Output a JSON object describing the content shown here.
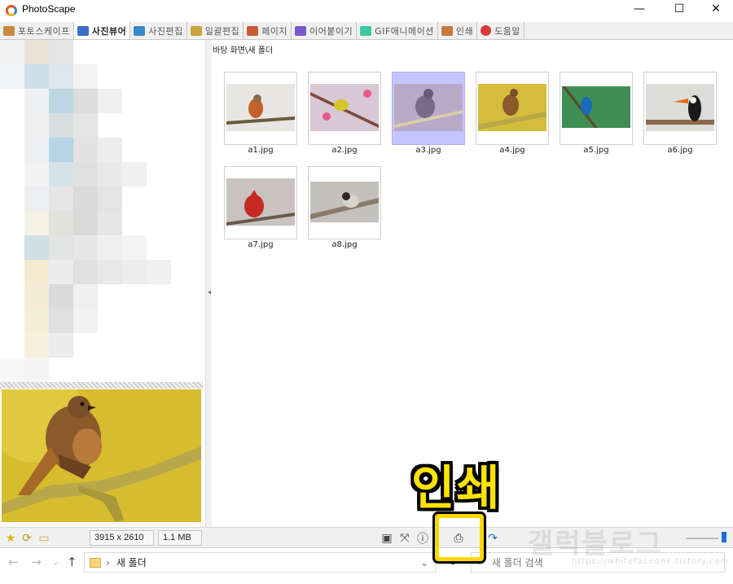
{
  "window": {
    "title": "PhotoScape",
    "minimize": "—",
    "maximize": "☐",
    "close": "✕"
  },
  "tabs": [
    {
      "label": "포토스케이프",
      "color": "#c98a3a",
      "active": false
    },
    {
      "label": "사진뷰어",
      "color": "#3a6fc9",
      "active": true
    },
    {
      "label": "사진편집",
      "color": "#3a8ac9",
      "active": false
    },
    {
      "label": "일괄편집",
      "color": "#c9a43a",
      "active": false
    },
    {
      "label": "페이지",
      "color": "#c95a3a",
      "active": false
    },
    {
      "label": "이어붙이기",
      "color": "#7a5ac9",
      "active": false
    },
    {
      "label": "GIF애니메이션",
      "color": "#3ac9a0",
      "active": false
    },
    {
      "label": "인쇄",
      "color": "#c97a3a",
      "active": false
    },
    {
      "label": "도움말",
      "color": "#d93a3a",
      "active": false
    }
  ],
  "path": "바탕 화면\\새 폴더",
  "thumbnails": [
    {
      "label": "a1.jpg",
      "selected": false,
      "bg": "#e8e6e2",
      "bird": "#c4622d",
      "branch": "#6b5a3a"
    },
    {
      "label": "a2.jpg",
      "selected": false,
      "bg": "#d8c8d6",
      "bird": "#d6c62a",
      "branch": "#7a4a3a"
    },
    {
      "label": "a3.jpg",
      "selected": true,
      "bg": "#b9a9c8",
      "bird": "#7a6a8a",
      "branch": "#d8cfa8"
    },
    {
      "label": "a4.jpg",
      "selected": false,
      "bg": "#d4bd3a",
      "bird": "#8a5a2a",
      "branch": "#b8a848"
    },
    {
      "label": "a5.jpg",
      "selected": false,
      "bg": "#3f8f55",
      "bird": "#1a6ab8",
      "branch": "#5a4a2a"
    },
    {
      "label": "a6.jpg",
      "selected": false,
      "bg": "#dcdcd8",
      "bird": "#1a1a1a",
      "branch": "#8a6a4a"
    },
    {
      "label": "a7.jpg",
      "selected": false,
      "bg": "#c8c2c0",
      "bird": "#c42a22",
      "branch": "#6a5a4a"
    },
    {
      "label": "a8.jpg",
      "selected": false,
      "bg": "#c4c0bc",
      "bird": "#2a2a2a",
      "branch": "#8a7a6a"
    }
  ],
  "overlay": {
    "label": "인쇄"
  },
  "status": {
    "dimensions": "3915 x 2610",
    "filesize": "1.1 MB",
    "icons": [
      "star-icon",
      "rotate-icon",
      "folder-icon",
      "slideshow-icon",
      "fullscreen-icon",
      "info-icon",
      "print-icon",
      "redo-icon"
    ]
  },
  "explorer": {
    "folder": "새 폴더",
    "search_placeholder": "새 폴더 검색"
  },
  "watermark": {
    "text": "갤럭블로그",
    "url": "https://whitefaceone.tistory.com"
  },
  "colors": {
    "accent": "#1a6fd6",
    "highlight": "#ffd800",
    "selected_thumb": "#c5c5ff"
  }
}
